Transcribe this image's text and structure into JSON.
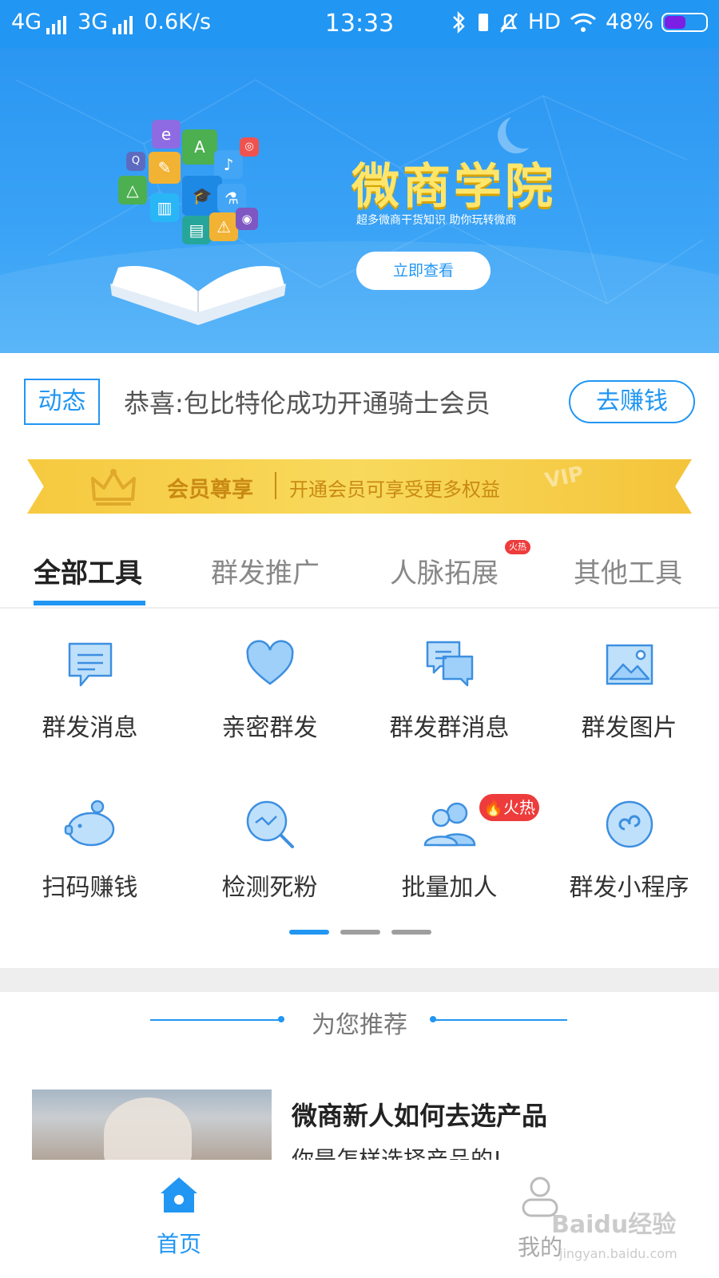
{
  "status_bar": {
    "network1": "4G",
    "network2": "3G",
    "speed": "0.6K/s",
    "time": "13:33",
    "hd": "HD",
    "battery_text": "48%",
    "battery_level": 0.48
  },
  "banner": {
    "title": "微商学院",
    "subtitle": "超多微商干货知识 助你玩转微商",
    "button": "立即查看"
  },
  "news": {
    "tag": "动态",
    "text": "恭喜:包比特伦成功开通骑士会员",
    "button": "去赚钱"
  },
  "vip": {
    "title": "会员尊享",
    "desc": "开通会员可享受更多权益",
    "mark": "VIP"
  },
  "tabs": [
    {
      "label": "全部工具",
      "active": true
    },
    {
      "label": "群发推广",
      "active": false
    },
    {
      "label": "人脉拓展",
      "active": false,
      "badge": "火热"
    },
    {
      "label": "其他工具",
      "active": false
    }
  ],
  "tools": [
    {
      "label": "群发消息",
      "icon": "message-icon"
    },
    {
      "label": "亲密群发",
      "icon": "heart-icon"
    },
    {
      "label": "群发群消息",
      "icon": "group-chat-icon"
    },
    {
      "label": "群发图片",
      "icon": "image-icon"
    },
    {
      "label": "扫码赚钱",
      "icon": "piggy-bank-icon"
    },
    {
      "label": "检测死粉",
      "icon": "magnifier-icon"
    },
    {
      "label": "批量加人",
      "icon": "users-icon",
      "badge": "火热"
    },
    {
      "label": "群发小程序",
      "icon": "mini-program-icon"
    }
  ],
  "pager": {
    "pages": 3,
    "current": 1
  },
  "recommend": {
    "title": "为您推荐"
  },
  "article": {
    "title": "微商新人如何去选产品",
    "subtitle": "你是怎样选择产品的!"
  },
  "bottom_nav": [
    {
      "label": "首页",
      "icon": "home-icon",
      "active": true
    },
    {
      "label": "我的",
      "icon": "user-icon",
      "active": false
    }
  ],
  "watermark": {
    "text": "Baidu经验",
    "sub": "jingyan.baidu.com"
  },
  "colors": {
    "primary": "#2196f3",
    "gold": "#c98a13",
    "hot": "#ee3b3b"
  }
}
